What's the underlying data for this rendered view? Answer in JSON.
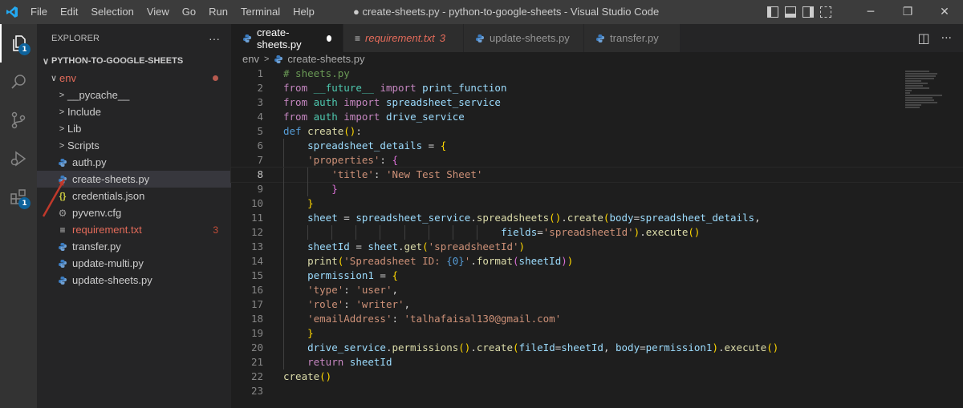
{
  "titlebar": {
    "menu": [
      "File",
      "Edit",
      "Selection",
      "View",
      "Go",
      "Run",
      "Terminal",
      "Help"
    ],
    "title": "● create-sheets.py - python-to-google-sheets - Visual Studio Code"
  },
  "activity": {
    "explorer_badge": "1",
    "extensions_badge": "1"
  },
  "sidebar": {
    "header": "EXPLORER",
    "more": "···",
    "section": "PYTHON-TO-GOOGLE-SHEETS",
    "items": [
      {
        "label": "env",
        "chevron": "∨",
        "icon": "",
        "color": "#e46b5a",
        "indent": 14,
        "git": "dot"
      },
      {
        "label": "__pycache__",
        "chevron": ">",
        "icon": "",
        "color": "#cccccc",
        "indent": 24,
        "git": ""
      },
      {
        "label": "Include",
        "chevron": ">",
        "icon": "",
        "color": "#cccccc",
        "indent": 24,
        "git": ""
      },
      {
        "label": "Lib",
        "chevron": ">",
        "icon": "",
        "color": "#cccccc",
        "indent": 24,
        "git": ""
      },
      {
        "label": "Scripts",
        "chevron": ">",
        "icon": "",
        "color": "#cccccc",
        "indent": 24,
        "git": ""
      },
      {
        "label": "auth.py",
        "chevron": "",
        "icon": "python-icon",
        "color": "#cccccc",
        "indent": 24,
        "git": ""
      },
      {
        "label": "create-sheets.py",
        "chevron": "",
        "icon": "python-icon",
        "color": "#cccccc",
        "indent": 24,
        "git": "",
        "selected": true
      },
      {
        "label": "credentials.json",
        "chevron": "",
        "icon": "json-icon",
        "color": "#cccccc",
        "indent": 24,
        "git": ""
      },
      {
        "label": "pyvenv.cfg",
        "chevron": "",
        "icon": "gear-icon",
        "color": "#cccccc",
        "indent": 24,
        "git": ""
      },
      {
        "label": "requirement.txt",
        "chevron": "",
        "icon": "text-file-icon",
        "color": "#e46b5a",
        "indent": 24,
        "git": "3"
      },
      {
        "label": "transfer.py",
        "chevron": "",
        "icon": "python-icon",
        "color": "#cccccc",
        "indent": 24,
        "git": ""
      },
      {
        "label": "update-multi.py",
        "chevron": "",
        "icon": "python-icon",
        "color": "#cccccc",
        "indent": 24,
        "git": ""
      },
      {
        "label": "update-sheets.py",
        "chevron": "",
        "icon": "python-icon",
        "color": "#cccccc",
        "indent": 24,
        "git": ""
      }
    ]
  },
  "tabs": [
    {
      "label": "create-sheets.py",
      "icon": "python-icon",
      "active": true,
      "dirty": true,
      "problems": ""
    },
    {
      "label": "requirement.txt",
      "icon": "text-file-icon",
      "active": false,
      "dirty": false,
      "problems": "3"
    },
    {
      "label": "update-sheets.py",
      "icon": "python-icon",
      "active": false,
      "dirty": false,
      "problems": ""
    },
    {
      "label": "transfer.py",
      "icon": "python-icon",
      "active": false,
      "dirty": false,
      "problems": ""
    }
  ],
  "tab_actions": [
    "split-editor-icon",
    "more-actions-icon"
  ],
  "tab_actions_text": [
    "◫",
    "···"
  ],
  "breadcrumb": {
    "folder": "env",
    "sep": ">",
    "file": "create-sheets.py"
  },
  "editor": {
    "current_line": 8,
    "lines": [
      {
        "n": "1",
        "indent": 0,
        "tokens": [
          [
            "cmt",
            "# sheets.py"
          ]
        ]
      },
      {
        "n": "2",
        "indent": 0,
        "tokens": [
          [
            "kw",
            "from"
          ],
          [
            "pl",
            " "
          ],
          [
            "mod",
            "__future__"
          ],
          [
            "pl",
            " "
          ],
          [
            "kw",
            "import"
          ],
          [
            "pl",
            " "
          ],
          [
            "var",
            "print_function"
          ]
        ]
      },
      {
        "n": "3",
        "indent": 0,
        "tokens": [
          [
            "kw",
            "from"
          ],
          [
            "pl",
            " "
          ],
          [
            "mod",
            "auth"
          ],
          [
            "pl",
            " "
          ],
          [
            "kw",
            "import"
          ],
          [
            "pl",
            " "
          ],
          [
            "var",
            "spreadsheet_service"
          ]
        ]
      },
      {
        "n": "4",
        "indent": 0,
        "tokens": [
          [
            "kw",
            "from"
          ],
          [
            "pl",
            " "
          ],
          [
            "mod",
            "auth"
          ],
          [
            "pl",
            " "
          ],
          [
            "kw",
            "import"
          ],
          [
            "pl",
            " "
          ],
          [
            "var",
            "drive_service"
          ]
        ]
      },
      {
        "n": "5",
        "indent": 0,
        "tokens": [
          [
            "def",
            "def"
          ],
          [
            "pl",
            " "
          ],
          [
            "fn",
            "create"
          ],
          [
            "br1",
            "()"
          ],
          [
            "pl",
            ":"
          ]
        ]
      },
      {
        "n": "6",
        "indent": 1,
        "tokens": [
          [
            "var",
            "spreadsheet_details"
          ],
          [
            "pl",
            " = "
          ],
          [
            "br1",
            "{"
          ]
        ]
      },
      {
        "n": "7",
        "indent": 1,
        "tokens": [
          [
            "str",
            "'properties'"
          ],
          [
            "pl",
            ": "
          ],
          [
            "br2",
            "{"
          ]
        ]
      },
      {
        "n": "8",
        "indent": 2,
        "tokens": [
          [
            "str",
            "'title'"
          ],
          [
            "pl",
            ": "
          ],
          [
            "str",
            "'New Test Sheet'"
          ]
        ]
      },
      {
        "n": "9",
        "indent": 2,
        "tokens": [
          [
            "br2",
            "}"
          ]
        ]
      },
      {
        "n": "10",
        "indent": 1,
        "tokens": [
          [
            "br1",
            "}"
          ]
        ]
      },
      {
        "n": "11",
        "indent": 1,
        "tokens": [
          [
            "var",
            "sheet"
          ],
          [
            "pl",
            " = "
          ],
          [
            "var",
            "spreadsheet_service"
          ],
          [
            "pl",
            "."
          ],
          [
            "fn",
            "spreadsheets"
          ],
          [
            "br1",
            "()"
          ],
          [
            "pl",
            "."
          ],
          [
            "fn",
            "create"
          ],
          [
            "br1",
            "("
          ],
          [
            "var",
            "body"
          ],
          [
            "pl",
            "="
          ],
          [
            "var",
            "spreadsheet_details"
          ],
          [
            "pl",
            ","
          ]
        ]
      },
      {
        "n": "12",
        "indent": 9,
        "tokens": [
          [
            "var",
            "fields"
          ],
          [
            "pl",
            "="
          ],
          [
            "str",
            "'spreadsheetId'"
          ],
          [
            "br1",
            ")"
          ],
          [
            "pl",
            "."
          ],
          [
            "fn",
            "execute"
          ],
          [
            "br1",
            "()"
          ]
        ]
      },
      {
        "n": "13",
        "indent": 1,
        "tokens": [
          [
            "var",
            "sheetId"
          ],
          [
            "pl",
            " = "
          ],
          [
            "var",
            "sheet"
          ],
          [
            "pl",
            "."
          ],
          [
            "fn",
            "get"
          ],
          [
            "br1",
            "("
          ],
          [
            "str",
            "'spreadsheetId'"
          ],
          [
            "br1",
            ")"
          ]
        ]
      },
      {
        "n": "14",
        "indent": 1,
        "tokens": [
          [
            "fn",
            "print"
          ],
          [
            "br1",
            "("
          ],
          [
            "str",
            "'Spreadsheet ID: "
          ],
          [
            "def",
            "{0}"
          ],
          [
            "str",
            "'"
          ],
          [
            "pl",
            "."
          ],
          [
            "fn",
            "format"
          ],
          [
            "br2",
            "("
          ],
          [
            "var",
            "sheetId"
          ],
          [
            "br2",
            ")"
          ],
          [
            "br1",
            ")"
          ]
        ]
      },
      {
        "n": "15",
        "indent": 1,
        "tokens": [
          [
            "var",
            "permission1"
          ],
          [
            "pl",
            " = "
          ],
          [
            "br1",
            "{"
          ]
        ]
      },
      {
        "n": "16",
        "indent": 1,
        "tokens": [
          [
            "str",
            "'type'"
          ],
          [
            "pl",
            ": "
          ],
          [
            "str",
            "'user'"
          ],
          [
            "pl",
            ","
          ]
        ]
      },
      {
        "n": "17",
        "indent": 1,
        "tokens": [
          [
            "str",
            "'role'"
          ],
          [
            "pl",
            ": "
          ],
          [
            "str",
            "'writer'"
          ],
          [
            "pl",
            ","
          ]
        ]
      },
      {
        "n": "18",
        "indent": 1,
        "tokens": [
          [
            "str",
            "'emailAddress'"
          ],
          [
            "pl",
            ": "
          ],
          [
            "str",
            "'talhafaisal130@gmail.com'"
          ]
        ]
      },
      {
        "n": "19",
        "indent": 1,
        "tokens": [
          [
            "br1",
            "}"
          ]
        ]
      },
      {
        "n": "20",
        "indent": 1,
        "tokens": [
          [
            "var",
            "drive_service"
          ],
          [
            "pl",
            "."
          ],
          [
            "fn",
            "permissions"
          ],
          [
            "br1",
            "()"
          ],
          [
            "pl",
            "."
          ],
          [
            "fn",
            "create"
          ],
          [
            "br1",
            "("
          ],
          [
            "var",
            "fileId"
          ],
          [
            "pl",
            "="
          ],
          [
            "var",
            "sheetId"
          ],
          [
            "pl",
            ", "
          ],
          [
            "var",
            "body"
          ],
          [
            "pl",
            "="
          ],
          [
            "var",
            "permission1"
          ],
          [
            "br1",
            ")"
          ],
          [
            "pl",
            "."
          ],
          [
            "fn",
            "execute"
          ],
          [
            "br1",
            "()"
          ]
        ]
      },
      {
        "n": "21",
        "indent": 1,
        "tokens": [
          [
            "kw",
            "return"
          ],
          [
            "pl",
            " "
          ],
          [
            "var",
            "sheetId"
          ]
        ]
      },
      {
        "n": "22",
        "indent": 0,
        "tokens": [
          [
            "fn",
            "create"
          ],
          [
            "br1",
            "()"
          ]
        ]
      },
      {
        "n": "23",
        "indent": 0,
        "tokens": []
      }
    ]
  }
}
